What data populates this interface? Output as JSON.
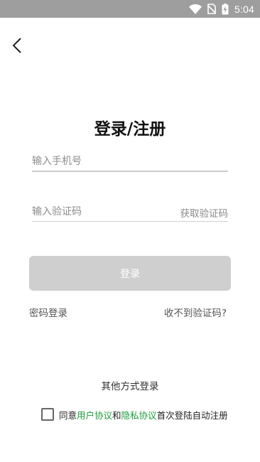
{
  "status_bar": {
    "time": "5:04",
    "icons": [
      "wifi-icon",
      "no-sim-icon",
      "battery-charging-icon"
    ],
    "background": "#9e9e9e"
  },
  "header": {
    "back_icon": "chevron-left-icon"
  },
  "title": "登录/注册",
  "form": {
    "phone_placeholder": "输入手机号",
    "code_placeholder": "输入验证码",
    "get_code_label": "获取验证码",
    "login_label": "登录",
    "login_button_color": "#cfcfcf"
  },
  "links": {
    "password_login": "密码登录",
    "no_code": "收不到验证码?"
  },
  "other_login": "其他方式登录",
  "agreement": {
    "checked": false,
    "prefix": "同意",
    "user_agreement": "用户协议",
    "and": "和",
    "privacy_agreement": "隐私协议",
    "suffix": "首次登陆自动注册",
    "link_color": "#1a9b3a"
  }
}
